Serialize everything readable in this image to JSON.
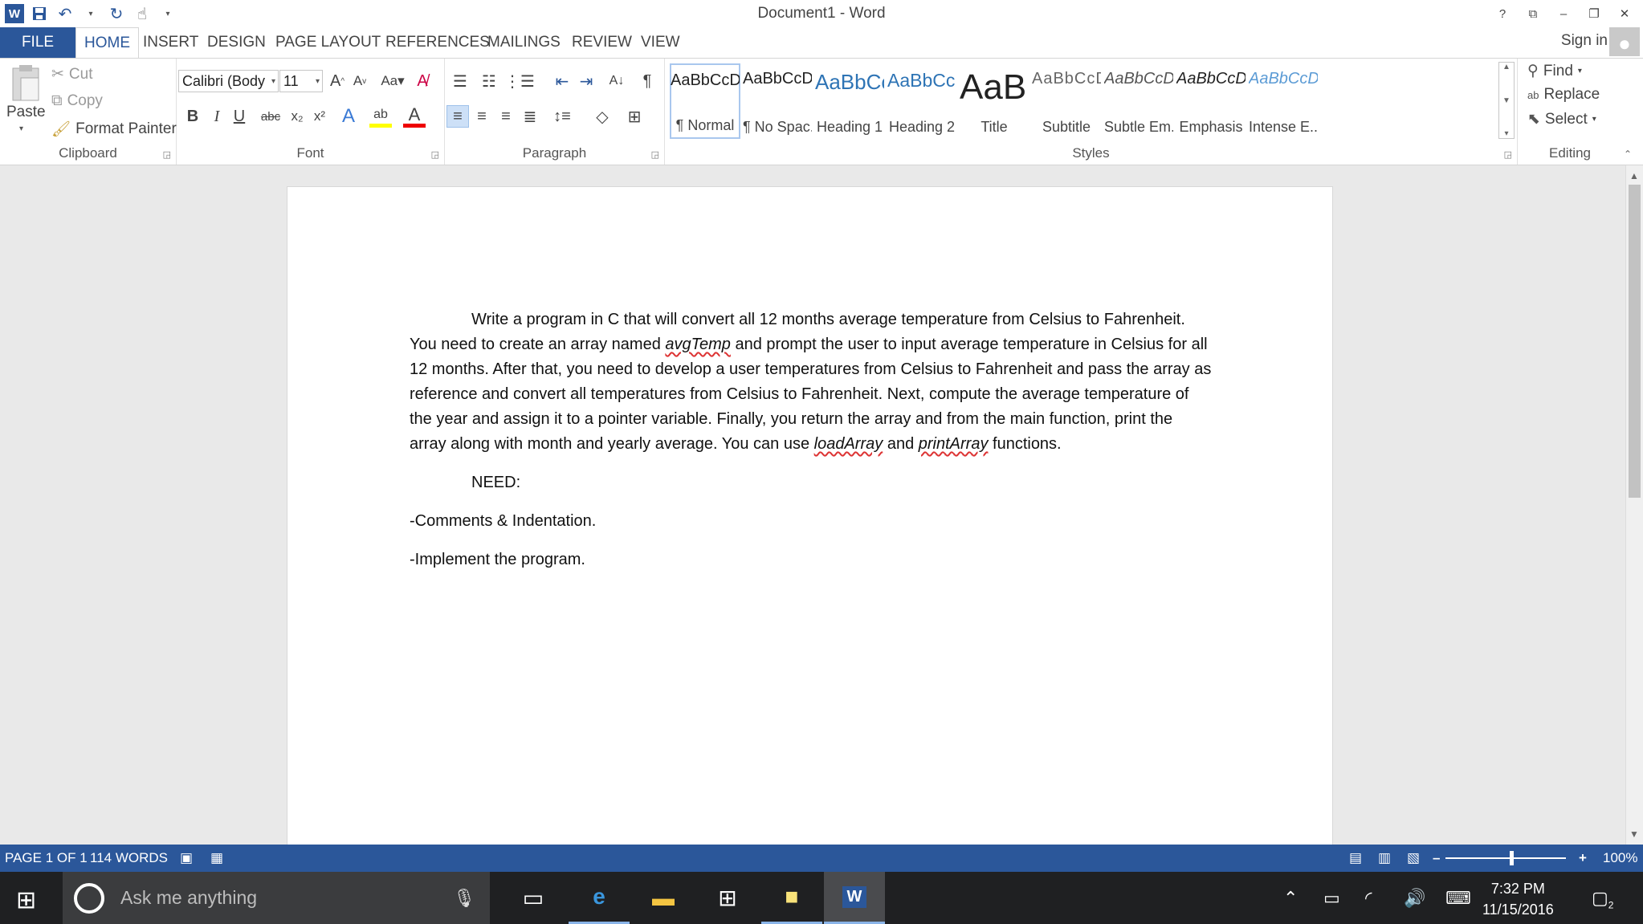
{
  "window": {
    "title": "Document1 - Word",
    "controls": [
      "?",
      "⧉",
      "–",
      "❐",
      "✕"
    ]
  },
  "tabs": {
    "file": "FILE",
    "home": "HOME",
    "insert": "INSERT",
    "design": "DESIGN",
    "page_layout": "PAGE LAYOUT",
    "references": "REFERENCES",
    "mailings": "MAILINGS",
    "review": "REVIEW",
    "view": "VIEW",
    "sign_in": "Sign in"
  },
  "clipboard": {
    "paste": "Paste",
    "cut": "Cut",
    "copy": "Copy",
    "format_painter": "Format Painter",
    "label": "Clipboard"
  },
  "font": {
    "name": "Calibri (Body",
    "size": "11",
    "label": "Font"
  },
  "paragraph": {
    "label": "Paragraph"
  },
  "styles": {
    "label": "Styles",
    "items": [
      {
        "sample": "AaBbCcDd",
        "name": "¶ Normal"
      },
      {
        "sample": "AaBbCcDd",
        "name": "¶ No Spac..."
      },
      {
        "sample": "AaBbCc",
        "name": "Heading 1"
      },
      {
        "sample": "AaBbCcD",
        "name": "Heading 2"
      },
      {
        "sample": "AaBl",
        "name": "Title"
      },
      {
        "sample": "AaBbCcD",
        "name": "Subtitle"
      },
      {
        "sample": "AaBbCcDd",
        "name": "Subtle Em..."
      },
      {
        "sample": "AaBbCcDd",
        "name": "Emphasis"
      },
      {
        "sample": "AaBbCcDd",
        "name": "Intense E..."
      }
    ]
  },
  "editing": {
    "find": "Find",
    "replace": "Replace",
    "select": "Select",
    "label": "Editing"
  },
  "document": {
    "p1_a": "Write a program in C that will convert all 12 months average temperature from Celsius to Fahrenheit. You need to create an array named ",
    "p1_var1": "avgTemp",
    "p1_b": " and prompt the user to input average temperature in Celsius for all 12 months. After that, you need to develop a user temperatures from Celsius to Fahrenheit and pass the array as reference and convert all temperatures from Celsius to Fahrenheit. Next, compute the average temperature of the year and assign it to a pointer variable. Finally, you return the array and from the main function, print the array along with month and yearly average. You can use ",
    "p1_var2": "loadArray",
    "p1_c": " and ",
    "p1_var3": "printArray",
    "p1_d": " functions.",
    "need": "NEED:",
    "item1": "-Comments & Indentation.",
    "item2": "-Implement the program."
  },
  "status": {
    "page": "PAGE 1 OF 1",
    "words": "114 WORDS",
    "zoom": "100%",
    "zoom_level": 1.0
  },
  "taskbar": {
    "search_placeholder": "Ask me anything",
    "time": "7:32 PM",
    "date": "11/15/2016",
    "notifications": "2"
  },
  "colors": {
    "accent": "#2b579a",
    "heading": "#2e74b5",
    "taskbar": "#1f2022"
  }
}
